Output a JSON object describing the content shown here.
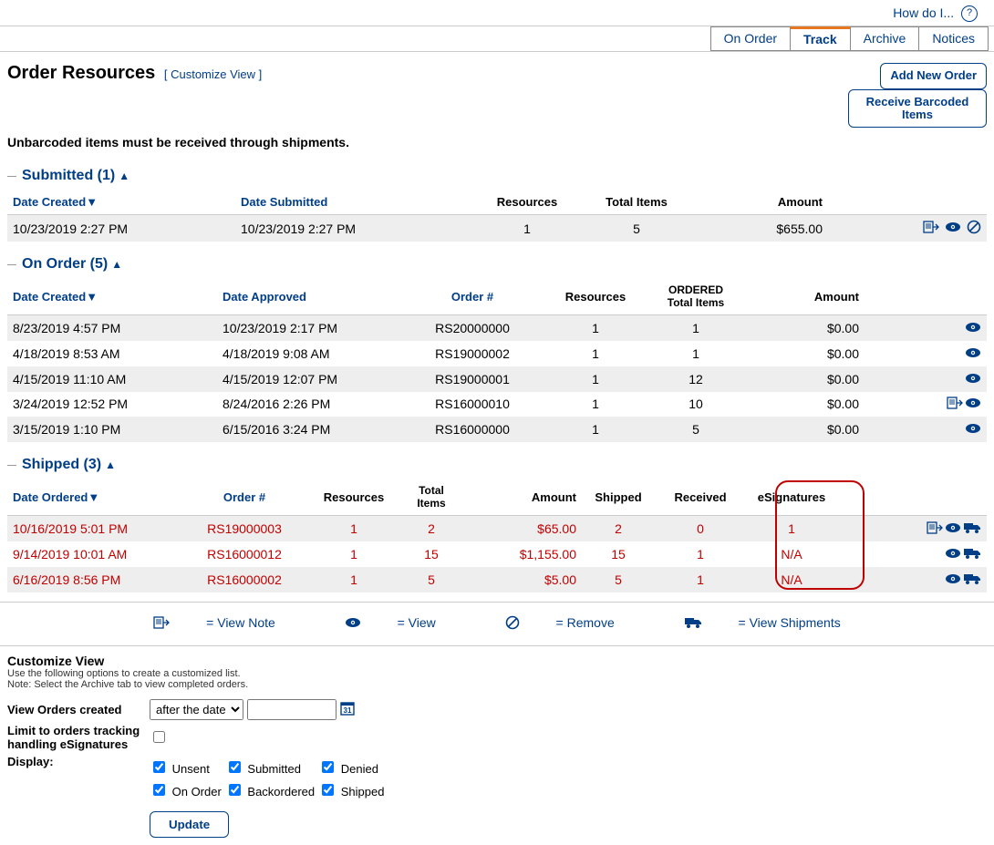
{
  "help_text": "How do I...",
  "tabs": [
    "On Order",
    "Track",
    "Archive",
    "Notices"
  ],
  "active_tab": "Track",
  "page_title": "Order Resources",
  "customize_link": "[ Customize View ]",
  "buttons": {
    "add": "Add New Order",
    "receive": "Receive Barcoded Items"
  },
  "note": "Unbarcoded items must be received through shipments.",
  "sections": {
    "submitted": {
      "title": "Submitted (1)",
      "cols": [
        "Date Created",
        "Date Submitted",
        "Resources",
        "Total Items",
        "Amount"
      ],
      "rows": [
        {
          "created": "10/23/2019 2:27 PM",
          "submitted": "10/23/2019 2:27 PM",
          "res": "1",
          "items": "5",
          "amount": "$655.00",
          "acts": [
            "note",
            "view",
            "remove"
          ]
        }
      ]
    },
    "onorder": {
      "title": "On Order (5)",
      "cols": [
        "Date Created",
        "Date Approved",
        "Order #",
        "Resources",
        "ORDERED Total Items",
        "Amount"
      ],
      "rows": [
        {
          "created": "8/23/2019 4:57 PM",
          "approved": "10/23/2019 2:17 PM",
          "order": "RS20000000",
          "res": "1",
          "items": "1",
          "amount": "$0.00",
          "acts": [
            "view"
          ]
        },
        {
          "created": "4/18/2019 8:53 AM",
          "approved": "4/18/2019 9:08 AM",
          "order": "RS19000002",
          "res": "1",
          "items": "1",
          "amount": "$0.00",
          "acts": [
            "view"
          ]
        },
        {
          "created": "4/15/2019 11:10 AM",
          "approved": "4/15/2019 12:07 PM",
          "order": "RS19000001",
          "res": "1",
          "items": "12",
          "amount": "$0.00",
          "acts": [
            "view"
          ]
        },
        {
          "created": "3/24/2019 12:52 PM",
          "approved": "8/24/2016 2:26 PM",
          "order": "RS16000010",
          "res": "1",
          "items": "10",
          "amount": "$0.00",
          "acts": [
            "note",
            "view"
          ]
        },
        {
          "created": "3/15/2019 1:10 PM",
          "approved": "6/15/2016 3:24 PM",
          "order": "RS16000000",
          "res": "1",
          "items": "5",
          "amount": "$0.00",
          "acts": [
            "view"
          ]
        }
      ]
    },
    "shipped": {
      "title": "Shipped (3)",
      "cols": [
        "Date Ordered",
        "Order #",
        "Resources",
        "Total Items",
        "Amount",
        "Shipped",
        "Received",
        "eSignatures"
      ],
      "rows": [
        {
          "ordered": "10/16/2019 5:01 PM",
          "order": "RS19000003",
          "res": "1",
          "items": "2",
          "amount": "$65.00",
          "shipped": "2",
          "received": "0",
          "esig": "1",
          "acts": [
            "note",
            "view",
            "truck"
          ]
        },
        {
          "ordered": "9/14/2019 10:01 AM",
          "order": "RS16000012",
          "res": "1",
          "items": "15",
          "amount": "$1,155.00",
          "shipped": "15",
          "received": "1",
          "esig": "N/A",
          "acts": [
            "view",
            "truck"
          ]
        },
        {
          "ordered": "6/16/2019 8:56 PM",
          "order": "RS16000002",
          "res": "1",
          "items": "5",
          "amount": "$5.00",
          "shipped": "5",
          "received": "1",
          "esig": "N/A",
          "acts": [
            "view",
            "truck"
          ]
        }
      ]
    }
  },
  "legend": {
    "note": "= View Note",
    "view": "= View",
    "remove": "= Remove",
    "truck": "= View Shipments"
  },
  "custom": {
    "title": "Customize View",
    "sub1": "Use the following options to create a customized list.",
    "sub2": "Note: Select the Archive tab to view completed orders.",
    "orders_label": "View Orders created",
    "select_val": "after the date",
    "date_val": "",
    "limit_label": "Limit to orders tracking handling eSignatures",
    "limit_checked": false,
    "display_label": "Display:",
    "checks": [
      {
        "label": "Unsent",
        "v": true
      },
      {
        "label": "Submitted",
        "v": true
      },
      {
        "label": "Denied",
        "v": true
      },
      {
        "label": "On Order",
        "v": true
      },
      {
        "label": "Backordered",
        "v": true
      },
      {
        "label": "Shipped",
        "v": true
      }
    ],
    "update": "Update"
  }
}
